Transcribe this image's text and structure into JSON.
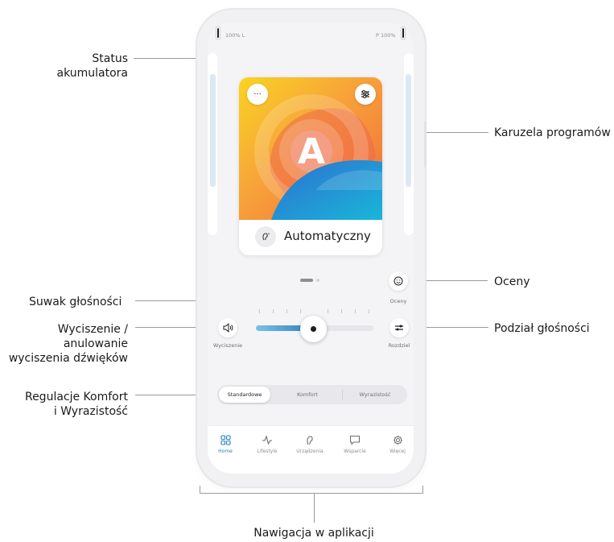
{
  "annotations": {
    "status_line1": "Status",
    "status_line2": "akumulatora",
    "carousel": "Karuzela programów",
    "ratings": "Oceny",
    "volume_slider": "Suwak głośności",
    "mute_line1": "Wyciszenie /",
    "mute_line2": "anulowanie",
    "mute_line3": "wyciszenia dźwięków",
    "comfort_line1": "Regulacje Komfort",
    "comfort_line2": "i Wyrazistość",
    "volume_split": "Podział głośności",
    "navigation": "Nawigacja w aplikacji"
  },
  "status_bar": {
    "left": "100% L",
    "right": "P 100%",
    "left_battery_level": 1.0,
    "right_battery_level": 1.0
  },
  "program": {
    "letter": "A",
    "name": "Automatyczny",
    "more_icon": "more-dots-icon",
    "settings_icon": "sliders-icon",
    "program_icon": "hearing-aid-icon"
  },
  "pager": {
    "count": 2,
    "active_index": 0
  },
  "controls": {
    "ratings_label": "Oceny",
    "mute_label": "Wyciszenie",
    "split_label": "Rozdziel",
    "volume_level": 0.49
  },
  "segments": [
    {
      "label": "Standardowe",
      "active": true
    },
    {
      "label": "Komfort",
      "active": false
    },
    {
      "label": "Wyrazistość",
      "active": false
    }
  ],
  "tabs": [
    {
      "label": "Home",
      "icon": "grid-icon",
      "active": true
    },
    {
      "label": "Lifestyle",
      "icon": "activity-icon",
      "active": false
    },
    {
      "label": "Urządzenia",
      "icon": "hearing-aid-icon",
      "active": false
    },
    {
      "label": "Wsparcie",
      "icon": "chat-icon",
      "active": false
    },
    {
      "label": "Więcej",
      "icon": "gear-icon",
      "active": false
    }
  ],
  "colors": {
    "accent": "#2b7fc0",
    "slider_start": "#7cc0e6",
    "slider_end": "#2b7fc0"
  }
}
